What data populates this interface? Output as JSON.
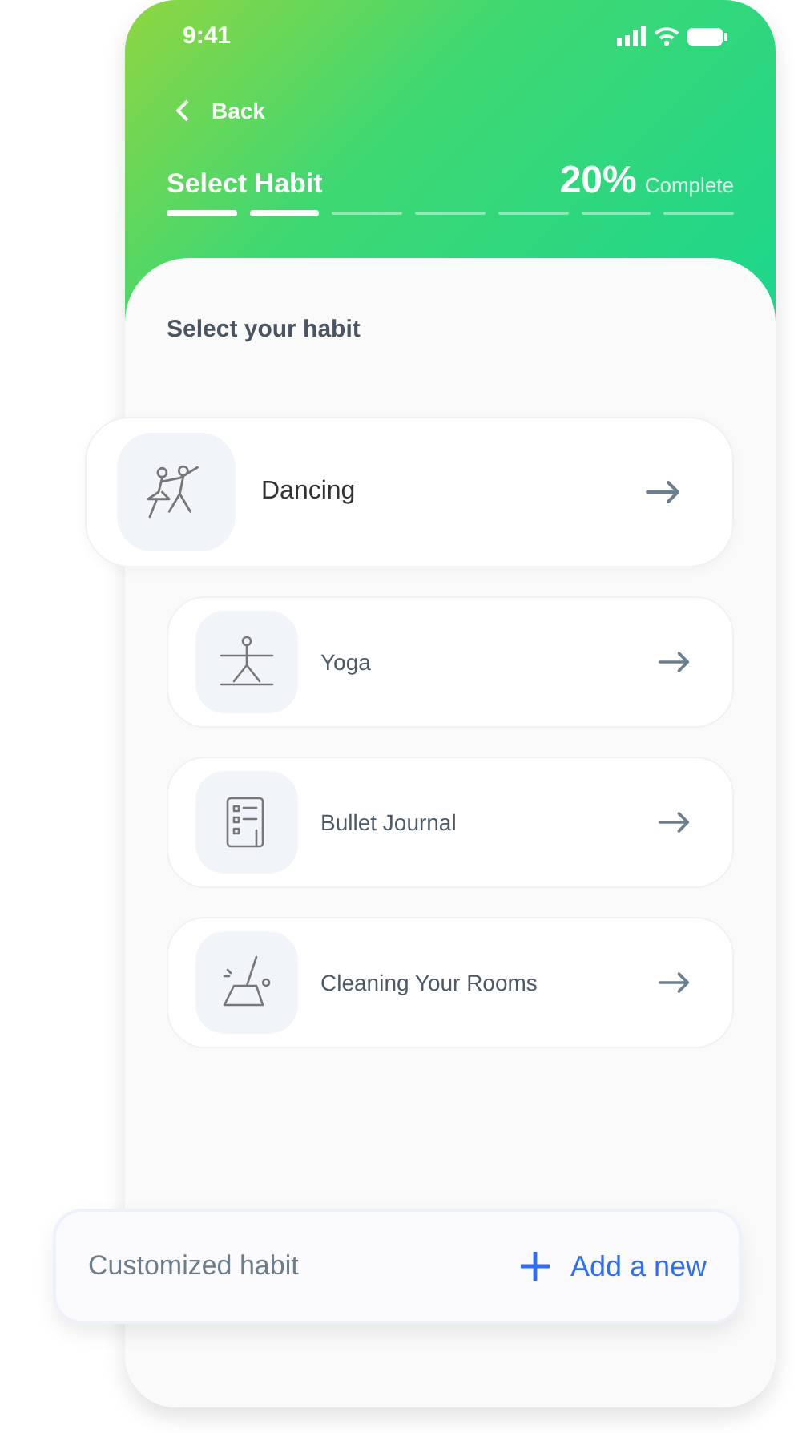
{
  "status_bar": {
    "time": "9:41"
  },
  "header": {
    "back": "Back",
    "title": "Select Habit",
    "percent": "20%",
    "percent_label": "Complete",
    "steps": [
      {
        "done": true
      },
      {
        "done": true
      },
      {
        "done": false
      },
      {
        "done": false
      },
      {
        "done": false
      },
      {
        "done": false
      },
      {
        "done": false
      }
    ]
  },
  "section_title": "Select your habit",
  "habits": [
    {
      "label": "Dancing",
      "selected": true
    },
    {
      "label": "Yoga",
      "selected": false
    },
    {
      "label": "Bullet Journal",
      "selected": false
    },
    {
      "label": "Cleaning Your Rooms",
      "selected": false
    }
  ],
  "custom": {
    "label": "Customized habit",
    "action": "Add a new"
  }
}
